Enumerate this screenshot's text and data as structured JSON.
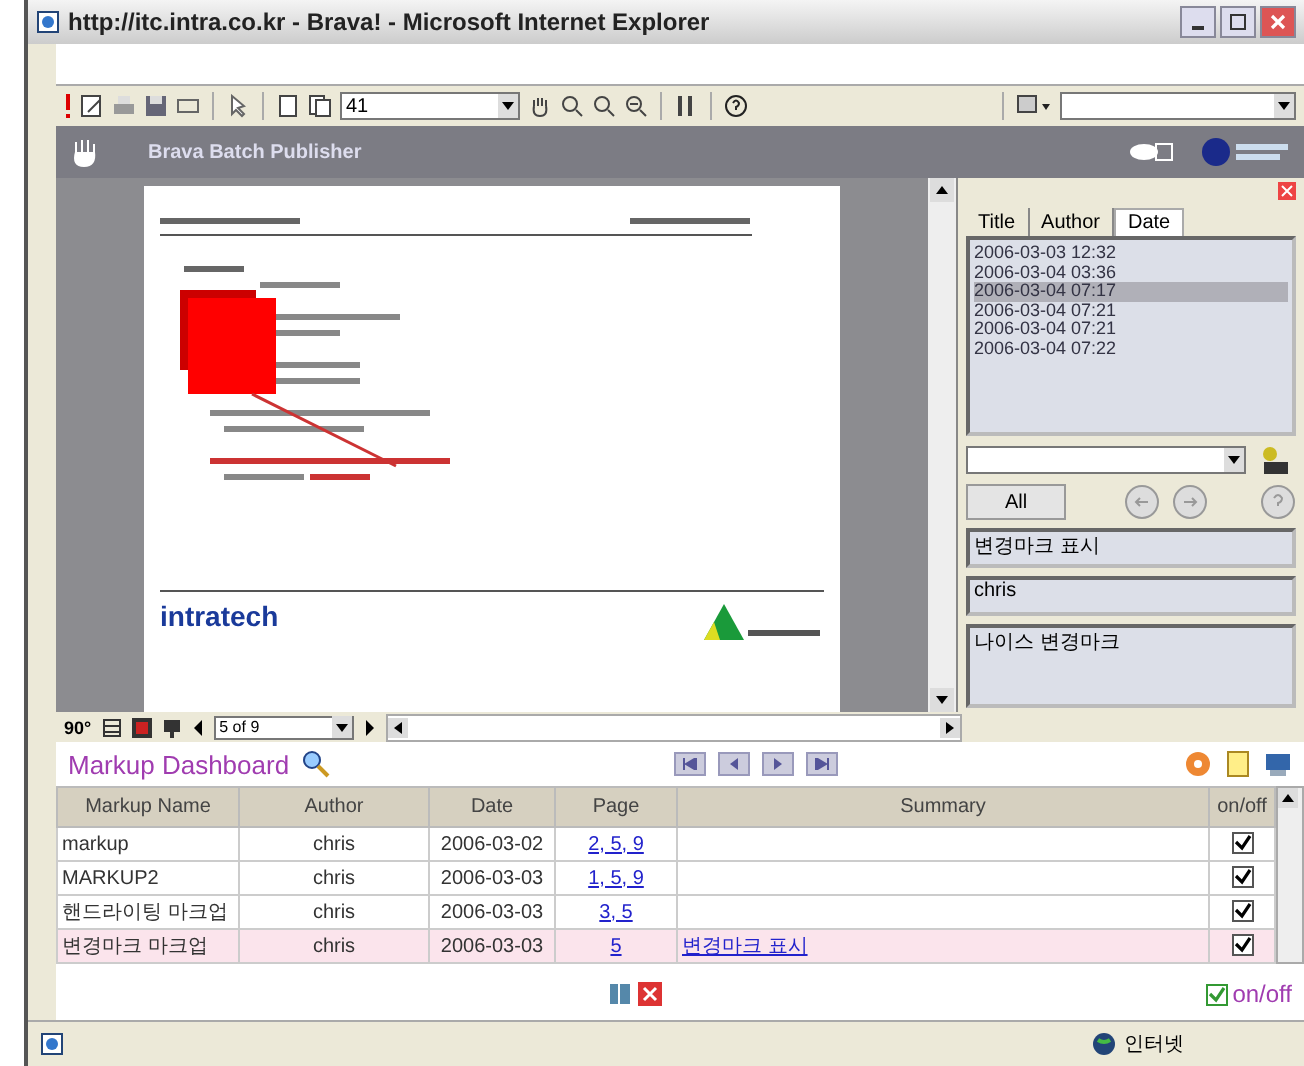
{
  "window": {
    "title": "http://itc.intra.co.kr - Brava! - Microsoft Internet Explorer"
  },
  "toolbar": {
    "page_field": "41"
  },
  "viewer_header": {
    "title": "Brava Batch Publisher"
  },
  "document": {
    "logo": "intratech"
  },
  "markup_panel": {
    "tabs": [
      {
        "label": "Title",
        "selected": false
      },
      {
        "label": "Author",
        "selected": false
      },
      {
        "label": "Date",
        "selected": true
      }
    ],
    "dates": [
      {
        "text": "2006-03-03 12:32",
        "selected": false
      },
      {
        "text": "2006-03-04 03:36",
        "selected": false
      },
      {
        "text": "2006-03-04 07:17",
        "selected": true
      },
      {
        "text": "2006-03-04 07:21",
        "selected": false
      },
      {
        "text": "2006-03-04 07:21",
        "selected": false
      },
      {
        "text": "2006-03-04 07:22",
        "selected": false
      }
    ],
    "all_button": "All",
    "label_field": "변경마크 표시",
    "author_field": "chris",
    "comment": "나이스 변경마크"
  },
  "viewer_footer": {
    "rotate": "90°",
    "page_select": "5 of 9"
  },
  "dashboard": {
    "title": "Markup Dashboard",
    "columns": [
      "Markup Name",
      "Author",
      "Date",
      "Page",
      "Summary",
      "on/off"
    ],
    "rows": [
      {
        "name": "markup",
        "author": "chris",
        "date": "2006-03-02",
        "pages": "2, 5, 9",
        "on": true,
        "selected": false
      },
      {
        "name": "MARKUP2",
        "author": "chris",
        "date": "2006-03-03",
        "pages": "1, 5, 9",
        "on": true,
        "selected": false
      },
      {
        "name": "핸드라이팅 마크업",
        "author": "chris",
        "date": "2006-03-03",
        "pages": "3, 5",
        "on": true,
        "selected": false
      },
      {
        "name": "변경마크 마크업",
        "author": "chris",
        "date": "2006-03-03",
        "pages": "5",
        "summary": "변경마크 표시",
        "on": true,
        "selected": true
      }
    ],
    "toggle": {
      "label": "on/off",
      "checked": true
    }
  },
  "status_bar": {
    "zone": "인터넷"
  }
}
